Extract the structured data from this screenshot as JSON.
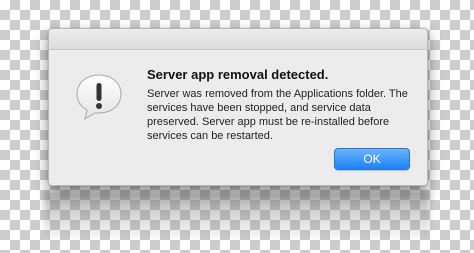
{
  "dialog": {
    "title": "Server app removal detected.",
    "message": "Server was removed from the Applications folder. The services have been stopped, and service data preserved. Server app must be re-installed before services can be restarted.",
    "ok_label": "OK",
    "icon": "alert-speech-bubble-icon",
    "accent_color": "#1a82fb"
  }
}
